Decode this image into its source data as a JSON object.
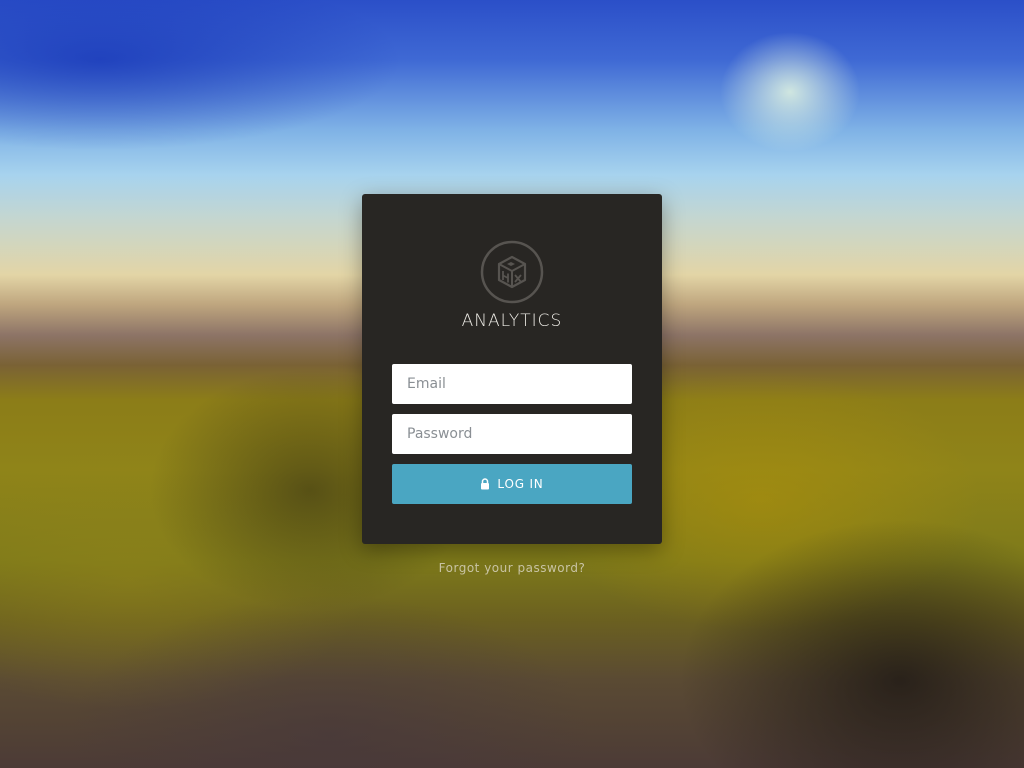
{
  "app": {
    "brand_name": "ANALYTICS",
    "logo_icon": "hx-cube-logo-icon"
  },
  "login_form": {
    "email_placeholder": "Email",
    "email_value": "",
    "password_placeholder": "Password",
    "password_value": "",
    "submit_label": "LOG IN",
    "submit_icon": "lock-icon"
  },
  "links": {
    "forgot_password": "Forgot your password?"
  },
  "colors": {
    "card_background": "#282623",
    "button_accent": "#4aa6c2",
    "link_text": "#c8c3a3"
  }
}
